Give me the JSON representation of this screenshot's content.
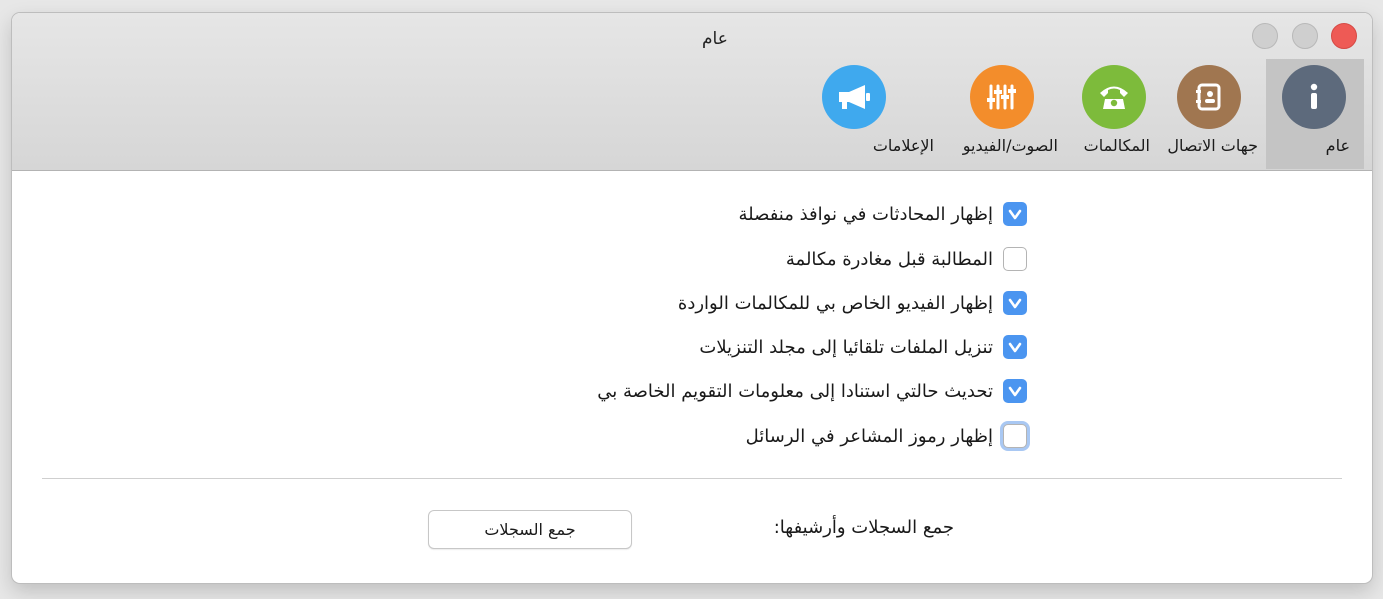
{
  "window": {
    "title": "عام"
  },
  "tabs": [
    {
      "label": "عام",
      "icon": "info-icon",
      "color": "#5d6a7c",
      "selected": true
    },
    {
      "label": "جهات الاتصال",
      "icon": "contacts-book-icon",
      "color": "#a07650"
    },
    {
      "label": "المكالمات",
      "icon": "phone-icon",
      "color": "#7dbb3b"
    },
    {
      "label": "الصوت/الفيديو",
      "icon": "sliders-icon",
      "color": "#f38d2b"
    },
    {
      "label": "الإعلامات",
      "icon": "megaphone-icon",
      "color": "#3fa9ee"
    }
  ],
  "options": [
    {
      "label": "إظهار المحادثات في نوافذ منفصلة",
      "checked": true
    },
    {
      "label": "المطالبة قبل مغادرة مكالمة",
      "checked": false
    },
    {
      "label": "إظهار الفيديو الخاص بي للمكالمات الواردة",
      "checked": true
    },
    {
      "label": "تنزيل الملفات تلقائيا إلى مجلد التنزيلات",
      "checked": true
    },
    {
      "label": "تحديث حالتي استنادا إلى معلومات التقويم الخاصة بي",
      "checked": true
    },
    {
      "label": "إظهار رموز المشاعر في الرسائل",
      "checked": false,
      "focused": true
    }
  ],
  "logs": {
    "label": "جمع السجلات وأرشيفها:",
    "button": "جمع السجلات"
  },
  "colors": {
    "accent": "#4b95f0",
    "close": "#ee5a55"
  }
}
